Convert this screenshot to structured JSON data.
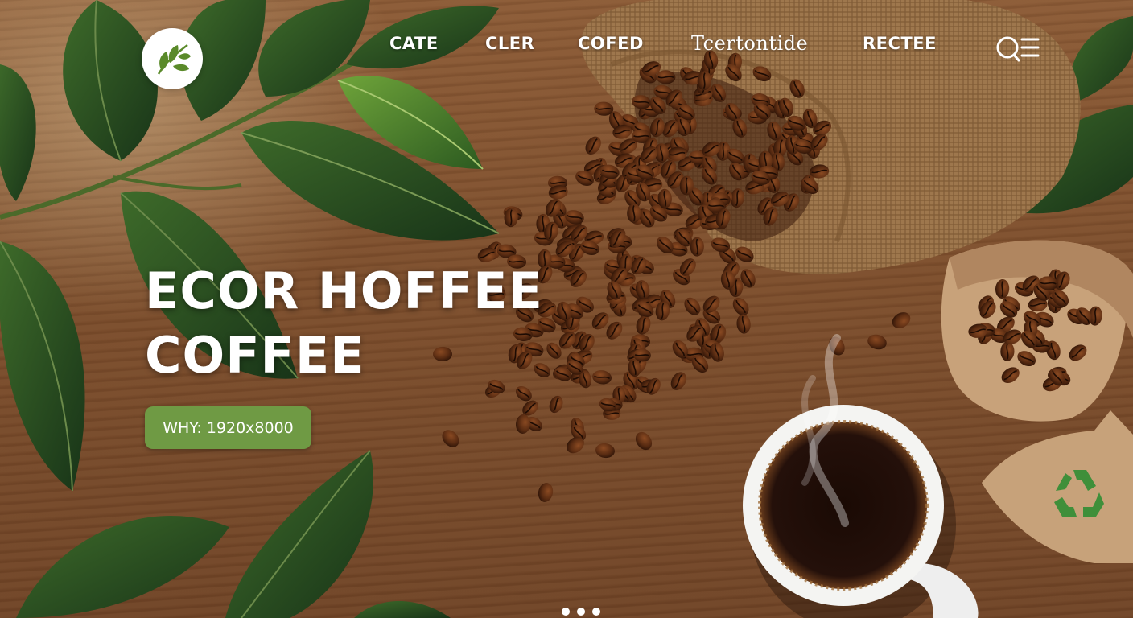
{
  "nav": {
    "items": [
      "CATE",
      "CLER",
      "COFED",
      "Tcertontide",
      "RECTEE"
    ]
  },
  "hero": {
    "headline_line1": "ECOR HOFFEE",
    "headline_line2": "COFFEE",
    "cta_label": "WHY: 1920x8000"
  },
  "icons": {
    "logo": "leaf-icon",
    "search": "search-icon",
    "menu": "menu-icon",
    "recycle": "recycle-icon"
  },
  "colors": {
    "accent_green": "#6f9a44",
    "wood": "#7b4d2c",
    "text": "#ffffff"
  },
  "carousel": {
    "slides": 3
  }
}
